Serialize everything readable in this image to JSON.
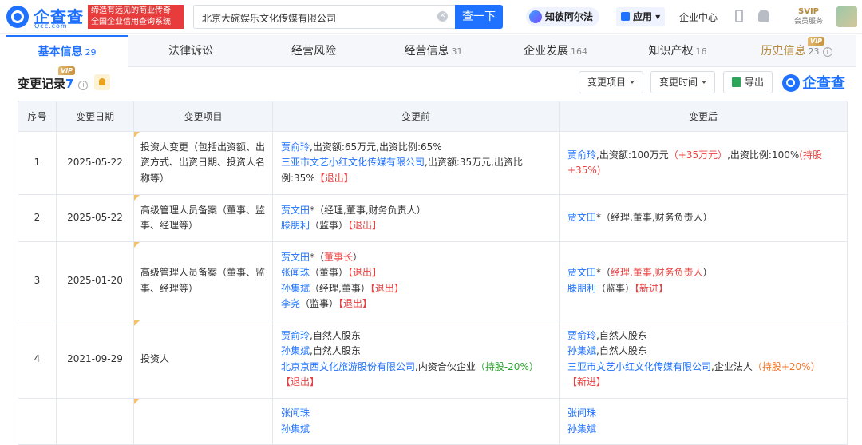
{
  "header": {
    "logo_text": "企查查",
    "logo_domain": "Qcc.com",
    "slogan_line1": "缔造有远见的商业传奇",
    "slogan_line2": "全国企业信用查询系统",
    "search_value": "北京大碗娱乐文化传媒有限公司",
    "search_button": "查一下",
    "zhibi_label": "知彼阿尔法",
    "apps_label": "应用",
    "enterprise_center": "企业中心",
    "svip_label": "SVIP",
    "svip_sub": "会员服务"
  },
  "tabs": [
    {
      "label": "基本信息",
      "count": "29",
      "active": true
    },
    {
      "label": "法律诉讼",
      "count": ""
    },
    {
      "label": "经营风险",
      "count": ""
    },
    {
      "label": "经营信息",
      "count": "31"
    },
    {
      "label": "企业发展",
      "count": "164"
    },
    {
      "label": "知识产权",
      "count": "16"
    },
    {
      "label": "历史信息",
      "count": "23",
      "vip": "VIP"
    }
  ],
  "section": {
    "title": "变更记录",
    "count": "7",
    "vip": "VIP",
    "filter_item": "变更项目",
    "filter_time": "变更时间",
    "export": "导出",
    "brand": "企查查"
  },
  "table": {
    "headers": [
      "序号",
      "变更日期",
      "变更项目",
      "变更前",
      "变更后"
    ],
    "rows": [
      {
        "no": "1",
        "date": "2025-05-22",
        "item": "投资人变更（包括出资额、出资方式、出资日期、投资人名称等）",
        "before": [
          [
            {
              "t": "贾俞玲",
              "c": "p"
            },
            {
              "t": ",出资额:65万元,出资比例:65%"
            }
          ],
          [
            {
              "t": "三亚市文艺小红文化传媒有限公司",
              "c": "p"
            },
            {
              "t": ",出资额:35万元,出资比例:35%"
            },
            {
              "t": "【退出】",
              "c": "r"
            }
          ]
        ],
        "after": [
          [
            {
              "t": "贾俞玲",
              "c": "p"
            },
            {
              "t": ",出资额:100万元"
            },
            {
              "t": "（+35万元）",
              "c": "r"
            },
            {
              "t": ",出资比例:100%"
            },
            {
              "t": "(持股+35%)",
              "c": "r"
            }
          ]
        ]
      },
      {
        "no": "2",
        "date": "2025-05-22",
        "item": "高级管理人员备案（董事、监事、经理等）",
        "before": [
          [
            {
              "t": "贾文田",
              "c": "p"
            },
            {
              "t": "*（经理,董事,财务负责人）"
            }
          ],
          [
            {
              "t": "滕朋利",
              "c": "p"
            },
            {
              "t": "（监事）"
            },
            {
              "t": "【退出】",
              "c": "r"
            }
          ]
        ],
        "after": [
          [
            {
              "t": "贾文田",
              "c": "p"
            },
            {
              "t": "*（经理,董事,财务负责人）"
            }
          ]
        ]
      },
      {
        "no": "3",
        "date": "2025-01-20",
        "item": "高级管理人员备案（董事、监事、经理等）",
        "before": [
          [
            {
              "t": "贾文田",
              "c": "p"
            },
            {
              "t": "*（"
            },
            {
              "t": "董事长",
              "c": "r"
            },
            {
              "t": "）"
            }
          ],
          [
            {
              "t": "张闻珠",
              "c": "p"
            },
            {
              "t": "（董事）"
            },
            {
              "t": "【退出】",
              "c": "r"
            }
          ],
          [
            {
              "t": "孙集斌",
              "c": "p"
            },
            {
              "t": "（经理,董事）"
            },
            {
              "t": "【退出】",
              "c": "r"
            }
          ],
          [
            {
              "t": "李尧",
              "c": "p"
            },
            {
              "t": "（监事）"
            },
            {
              "t": "【退出】",
              "c": "r"
            }
          ]
        ],
        "after": [
          [
            {
              "t": "贾文田",
              "c": "p"
            },
            {
              "t": "*（"
            },
            {
              "t": "经理,董事,财务负责人",
              "c": "r"
            },
            {
              "t": "）"
            }
          ],
          [
            {
              "t": "滕朋利",
              "c": "p"
            },
            {
              "t": "（监事）"
            },
            {
              "t": "【新进】",
              "c": "r"
            }
          ]
        ]
      },
      {
        "no": "4",
        "date": "2021-09-29",
        "item": "投资人",
        "before": [
          [
            {
              "t": "贾俞玲",
              "c": "p"
            },
            {
              "t": ",自然人股东"
            }
          ],
          [
            {
              "t": "孙集斌",
              "c": "p"
            },
            {
              "t": ",自然人股东"
            }
          ],
          [
            {
              "t": "北京京西文化旅游股份有限公司",
              "c": "p"
            },
            {
              "t": ",内资合伙企业"
            },
            {
              "t": "（持股-20%）",
              "c": "g"
            }
          ],
          [
            {
              "t": "【退出】",
              "c": "r"
            }
          ]
        ],
        "after": [
          [
            {
              "t": "贾俞玲",
              "c": "p"
            },
            {
              "t": ",自然人股东"
            }
          ],
          [
            {
              "t": "孙集斌",
              "c": "p"
            },
            {
              "t": ",自然人股东"
            }
          ],
          [
            {
              "t": "三亚市文艺小红文化传媒有限公司",
              "c": "p"
            },
            {
              "t": ",企业法人"
            },
            {
              "t": "（持股+20%）",
              "c": "o"
            }
          ],
          [
            {
              "t": "【新进】",
              "c": "r"
            }
          ]
        ]
      },
      {
        "no": "",
        "date": "",
        "item": "",
        "before": [
          [
            {
              "t": "张闻珠",
              "c": "p"
            }
          ],
          [
            {
              "t": "孙集斌",
              "c": "p"
            }
          ]
        ],
        "after": [
          [
            {
              "t": "张闻珠",
              "c": "p"
            }
          ],
          [
            {
              "t": "孙集斌",
              "c": "p"
            }
          ]
        ]
      }
    ]
  },
  "colors": {
    "brand_blue": "#1e72ff",
    "red": "#e84040",
    "green": "#29a52c",
    "orange": "#f2772b",
    "vip_gold": "#b88a3e"
  }
}
